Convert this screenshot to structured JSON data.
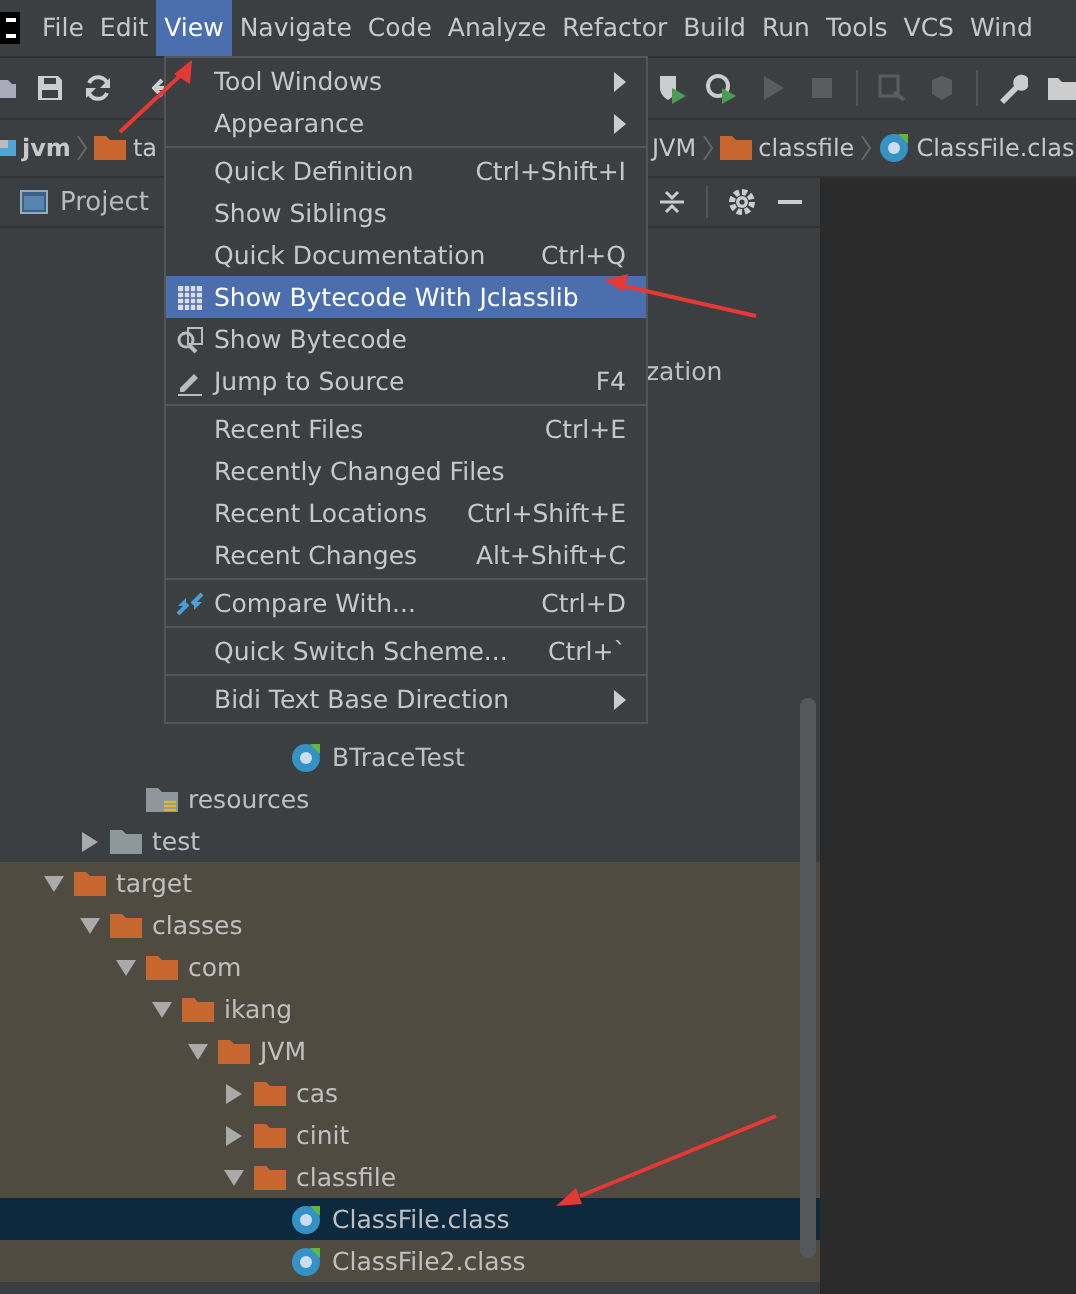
{
  "menubar": [
    {
      "label": "File",
      "selected": false
    },
    {
      "label": "Edit",
      "selected": false
    },
    {
      "label": "View",
      "selected": true
    },
    {
      "label": "Navigate",
      "selected": false
    },
    {
      "label": "Code",
      "selected": false
    },
    {
      "label": "Analyze",
      "selected": false
    },
    {
      "label": "Refactor",
      "selected": false
    },
    {
      "label": "Build",
      "selected": false
    },
    {
      "label": "Run",
      "selected": false
    },
    {
      "label": "Tools",
      "selected": false
    },
    {
      "label": "VCS",
      "selected": false
    },
    {
      "label": "Wind",
      "selected": false
    }
  ],
  "toolbar": {
    "right_buttons": [
      {
        "disabled": false
      },
      {
        "disabled": false
      },
      {
        "disabled": true
      },
      {
        "disabled": true
      },
      {
        "disabled": true
      },
      {
        "disabled": true
      },
      {
        "disabled": false
      },
      {
        "disabled": false
      }
    ]
  },
  "breadcrumb": {
    "left": [
      {
        "label": "jvm",
        "kind": "module"
      },
      {
        "label": "ta",
        "kind": "folder"
      }
    ],
    "right": [
      {
        "label": "JVM",
        "kind": "text"
      },
      {
        "label": "classfile",
        "kind": "folder"
      },
      {
        "label": "ClassFile.clas",
        "kind": "class"
      }
    ]
  },
  "project_panel": {
    "title": "Project"
  },
  "view_menu": [
    {
      "kind": "item",
      "label": "Tool Windows",
      "submenu": true,
      "selected": false
    },
    {
      "kind": "item",
      "label": "Appearance",
      "submenu": true,
      "selected": false
    },
    {
      "kind": "separator"
    },
    {
      "kind": "item",
      "label": "Quick Definition",
      "shortcut": "Ctrl+Shift+I",
      "selected": false
    },
    {
      "kind": "item",
      "label": "Show Siblings",
      "selected": false
    },
    {
      "kind": "item",
      "label": "Quick Documentation",
      "shortcut": "Ctrl+Q",
      "selected": false
    },
    {
      "kind": "item",
      "label": "Show Bytecode With Jclasslib",
      "selected": true
    },
    {
      "kind": "item",
      "label": "Show Bytecode",
      "selected": false
    },
    {
      "kind": "item",
      "label": "Jump to Source",
      "shortcut": "F4",
      "selected": false
    },
    {
      "kind": "separator"
    },
    {
      "kind": "item",
      "label": "Recent Files",
      "shortcut": "Ctrl+E",
      "selected": false
    },
    {
      "kind": "item",
      "label": "Recently Changed Files",
      "selected": false
    },
    {
      "kind": "item",
      "label": "Recent Locations",
      "shortcut": "Ctrl+Shift+E",
      "selected": false
    },
    {
      "kind": "item",
      "label": "Recent Changes",
      "shortcut": "Alt+Shift+C",
      "selected": false
    },
    {
      "kind": "separator"
    },
    {
      "kind": "item",
      "label": "Compare With...",
      "shortcut": "Ctrl+D",
      "selected": false
    },
    {
      "kind": "separator"
    },
    {
      "kind": "item",
      "label": "Quick Switch Scheme...",
      "shortcut": "Ctrl+`",
      "selected": false
    },
    {
      "kind": "separator"
    },
    {
      "kind": "item",
      "label": "Bidi Text Base Direction",
      "submenu": true,
      "selected": false
    }
  ],
  "partly_hidden_text": "zation",
  "tree": [
    {
      "children": [
        {
          "children": [
            {
              "children": [
                {
                  "children": [
                    {
                      "children": [
                        {
                          "children": [
                            {
                              "label": "BTraceTest",
                              "kind": "class",
                              "selected": false
                            }
                          ]
                        }
                      ]
                    }
                  ]
                }
              ]
            },
            {
              "label": "resources",
              "kind": "resources",
              "selected": false
            }
          ]
        },
        {
          "label": "test",
          "kind": "folder_gray",
          "expanded": false,
          "selected": false
        }
      ]
    },
    {
      "label": "target",
      "kind": "folder",
      "expanded": true,
      "excluded": true,
      "selected": false,
      "children": [
        {
          "label": "classes",
          "kind": "folder",
          "expanded": true,
          "excluded": true,
          "selected": false,
          "children": [
            {
              "label": "com",
              "kind": "folder",
              "expanded": true,
              "excluded": true,
              "selected": false,
              "children": [
                {
                  "label": "ikang",
                  "kind": "folder",
                  "expanded": true,
                  "excluded": true,
                  "selected": false,
                  "children": [
                    {
                      "label": "JVM",
                      "kind": "folder",
                      "expanded": true,
                      "excluded": true,
                      "selected": false,
                      "children": [
                        {
                          "label": "cas",
                          "kind": "folder",
                          "expanded": false,
                          "excluded": true,
                          "selected": false
                        },
                        {
                          "label": "cinit",
                          "kind": "folder",
                          "expanded": false,
                          "excluded": true,
                          "selected": false
                        },
                        {
                          "label": "classfile",
                          "kind": "folder",
                          "expanded": true,
                          "excluded": true,
                          "selected": false,
                          "children": [
                            {
                              "label": "ClassFile.class",
                              "kind": "class",
                              "excluded": true,
                              "selected": true
                            },
                            {
                              "label": "ClassFile2.class",
                              "kind": "class",
                              "excluded": true,
                              "selected": false
                            }
                          ]
                        }
                      ]
                    }
                  ]
                }
              ]
            }
          ]
        }
      ]
    }
  ]
}
